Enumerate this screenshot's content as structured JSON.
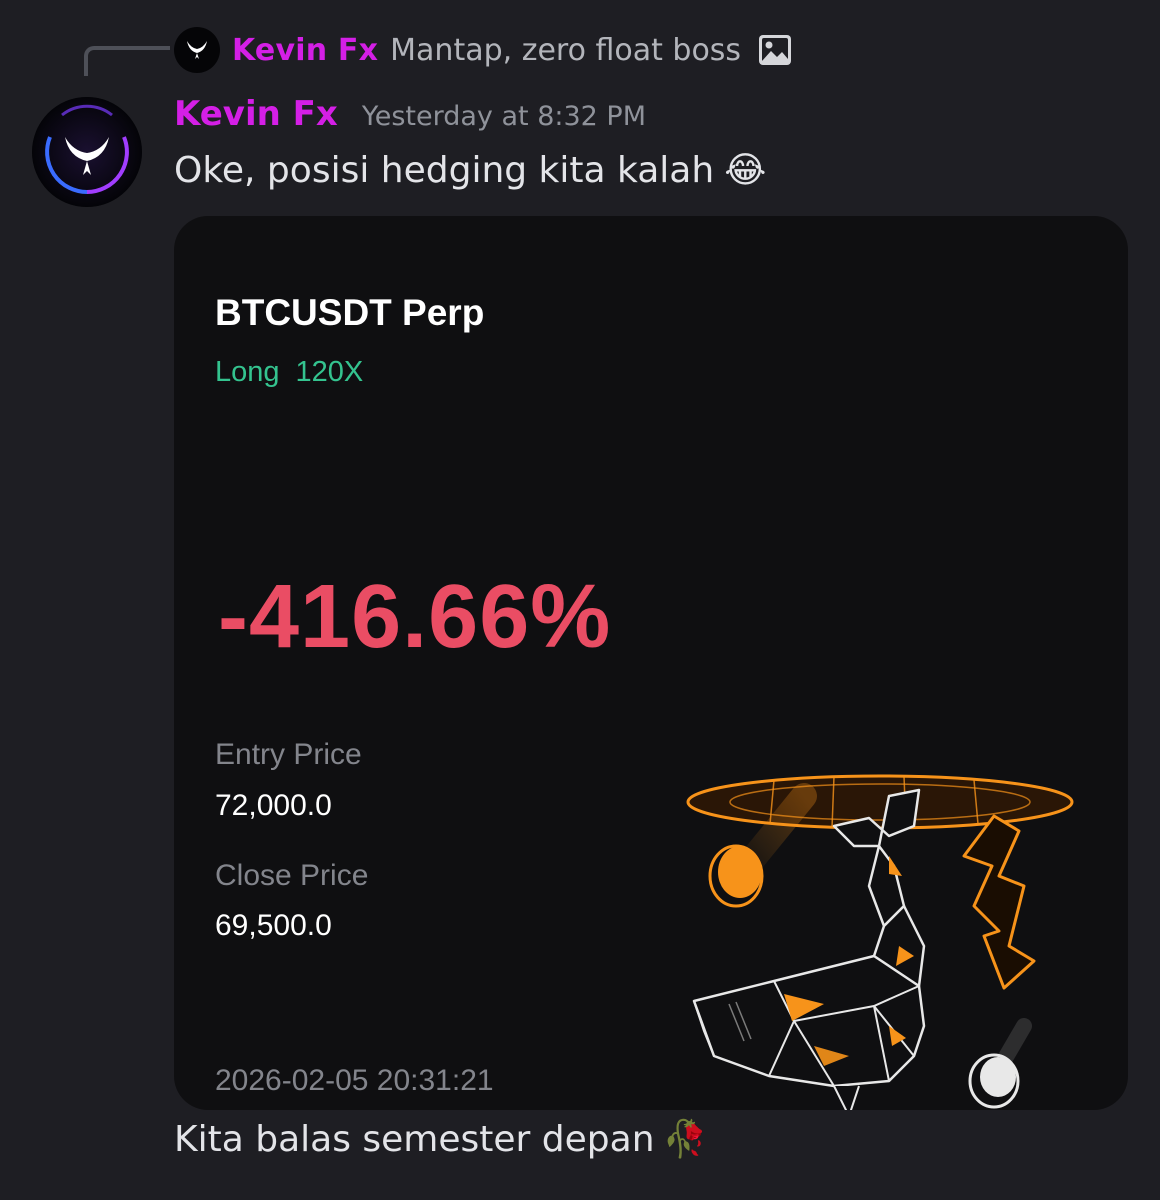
{
  "reply": {
    "author": "Kevin Fx",
    "text": "Mantap, zero float boss",
    "attachment_icon": "image-icon"
  },
  "message": {
    "author": "Kevin Fx",
    "timestamp": "Yesterday at 8:32 PM",
    "text": "Oke, posisi hedging kita kalah",
    "text_emoji": "😂",
    "followup_text": "Kita balas semester depan",
    "followup_emoji": "🥀"
  },
  "trade_card": {
    "pair": "BTCUSDT Perp",
    "side": "Long",
    "leverage": "120X",
    "pnl_percent": "-416.66%",
    "entry_label": "Entry Price",
    "entry_value": "72,000.0",
    "close_label": "Close Price",
    "close_value": "69,500.0",
    "datetime": "2026-02-05 20:31:21",
    "illustration": "whale-portal-illustration"
  },
  "colors": {
    "background": "#1e1e23",
    "author": "#d41fe6",
    "long": "#34c38f",
    "loss": "#ea4d64",
    "card": "#0f0f11",
    "accent": "#f7931a"
  }
}
